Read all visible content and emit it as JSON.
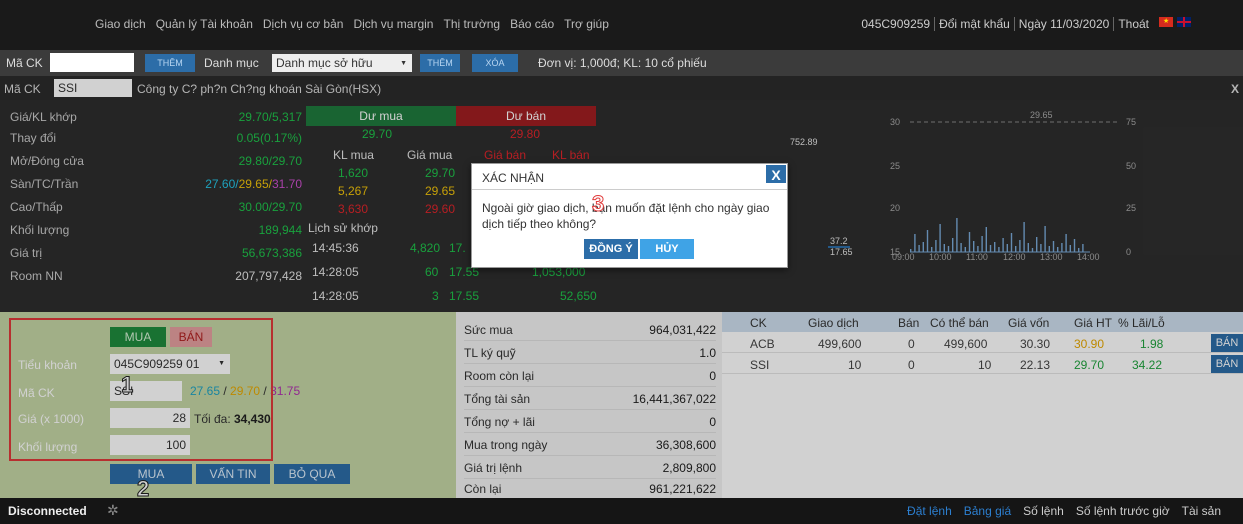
{
  "nav": {
    "menu": [
      "Giao dịch",
      "Quản lý Tài khoản",
      "Dịch vụ cơ bản",
      "Dịch vụ margin",
      "Thị trường",
      "Báo cáo",
      "Trợ giúp"
    ],
    "account": [
      "045C909259",
      "Đổi mật khẩu",
      "Ngày 11/03/2020",
      "Thoát"
    ],
    "flags": [
      "vn-flag-icon",
      "uk-flag-icon"
    ]
  },
  "toolbar": {
    "code_label": "Mã CK",
    "add_label": "THÊM",
    "list_label": "Danh mục",
    "list_select": "Danh mục sở hữu",
    "add2_label": "THÊM",
    "delete_label": "XÓA",
    "unit_text": "Đơn vị: 1,000đ; KL: 10 cổ phiếu"
  },
  "quote_header": {
    "label": "Mã CK",
    "symbol": "SSI",
    "company": "Công ty C? ph?n Ch?ng khoán Sài Gòn(HSX)",
    "close": "X"
  },
  "quote": {
    "rows": [
      {
        "k": "Giá/KL khớp",
        "v1": "29.70",
        "v2": "/5,317"
      },
      {
        "k": "Thay đổi",
        "v1": "0.05(0.17%)",
        "v2": ""
      },
      {
        "k": "Mở/Đóng cửa",
        "v1": "29.80",
        "v2": "/29.70"
      },
      {
        "k": "Sàn/TC/Trần",
        "v1": "27.60/",
        "v2": "29.65/",
        "v3": "31.70"
      },
      {
        "k": "Cao/Thấp",
        "v1": "30.00",
        "v2": "/29.70"
      },
      {
        "k": "Khối lượng",
        "v1": "189,944",
        "v2": ""
      },
      {
        "k": "Giá trị",
        "v1": "56,673,386",
        "v2": ""
      },
      {
        "k": "Room NN",
        "v1": "207,797,428",
        "v2": ""
      }
    ],
    "buy_head": "Dư mua",
    "sell_head": "Dư bán",
    "buy_total": "29.70",
    "sell_total": "29.80",
    "col_kl_mua": "KL mua",
    "col_gia_mua": "Giá mua",
    "col_gia_ban": "Giá bán",
    "col_kl_ban": "KL bán",
    "depth": [
      {
        "kl": "1,620",
        "gia": "29.70"
      },
      {
        "kl": "5,267",
        "gia": "29.65"
      },
      {
        "kl": "3,630",
        "gia": "29.60"
      }
    ],
    "history_label": "Lịch sử khớp",
    "history": [
      {
        "t": "14:45:36",
        "kl": "4,820",
        "p": "17."
      },
      {
        "t": "14:28:05",
        "kl": "60",
        "p": "17.55",
        "amt": "1,053,000"
      },
      {
        "t": "14:28:05",
        "kl": "3",
        "p": "17.55",
        "amt": "52,650"
      }
    ],
    "mini_vals": [
      "752.89",
      "37.2",
      "17.65"
    ]
  },
  "chart_data": {
    "type": "line",
    "title": "",
    "xlabel": "",
    "ylabel": "",
    "x": [
      "09:00",
      "10:00",
      "11:00",
      "12:00",
      "13:00",
      "14:00"
    ],
    "y_left_ticks": [
      "30",
      "25",
      "20",
      "15"
    ],
    "y_right_ticks": [
      "75",
      "50",
      "25",
      "0"
    ],
    "reference_label": "29.65",
    "series": [
      {
        "values": [
          29.8,
          29.9,
          30.0,
          29.85,
          29.75,
          29.7
        ]
      }
    ]
  },
  "order": {
    "buy_tab": "MUA",
    "sell_tab": "BÁN",
    "account_label": "Tiểu khoản",
    "account_value": "045C909259 01",
    "code_label": "Mã CK",
    "code_value": "SSI",
    "code_floor": "27.65",
    "code_sep1": " / ",
    "code_ref": "29.70",
    "code_sep2": " / ",
    "code_ceil": "31.75",
    "price_label": "Giá (x 1000)",
    "price_value": "28",
    "max_label": "Tối đa:",
    "max_value": "34,430",
    "qty_label": "Khối lượng",
    "qty_value": "100",
    "submit_label": "MUA",
    "ask_label": "VẤN TIN",
    "skip_label": "BỎ QUA",
    "badge1": "1",
    "badge2": "2"
  },
  "summary": {
    "rows": [
      {
        "k": "Sức mua",
        "v": "964,031,422"
      },
      {
        "k": "TL ký quỹ",
        "v": "1.0"
      },
      {
        "k": "Room còn lại",
        "v": "0"
      },
      {
        "k": "Tổng tài sản",
        "v": "16,441,367,022"
      },
      {
        "k": "Tổng nợ + lãi",
        "v": "0"
      },
      {
        "k": "Mua trong ngày",
        "v": "36,308,600"
      },
      {
        "k": "Giá trị lệnh",
        "v": "2,809,800"
      },
      {
        "k": "Còn lại",
        "v": "961,221,622"
      }
    ]
  },
  "portfolio": {
    "headers": [
      "CK",
      "Giao dịch",
      "Bán",
      "Có thể bán",
      "Giá vốn",
      "Giá HT",
      "% Lãi/Lỗ"
    ],
    "rows": [
      {
        "ck": "ACB",
        "gd": "499,600",
        "ban": "0",
        "ctb": "499,600",
        "gv": "30.30",
        "ght": "30.90",
        "pct": "1.98",
        "btn": "BÁN"
      },
      {
        "ck": "SSI",
        "gd": "10",
        "ban": "0",
        "ctb": "10",
        "gv": "22.13",
        "ght": "29.70",
        "pct": "34.22",
        "btn": "BÁN"
      }
    ]
  },
  "status": {
    "connection": "Disconnected",
    "links": [
      "Đặt lệnh",
      "Bảng giá",
      "Số lệnh",
      "Số lệnh trước giờ",
      "Tài sản"
    ]
  },
  "modal": {
    "title": "XÁC NHẬN",
    "close": "X",
    "message": "Ngoài giờ giao dịch, bạn muốn đặt lệnh cho ngày giao dịch tiếp theo không?",
    "ok_label": "ĐỒNG Ý",
    "cancel_label": "HỦY",
    "badge3": "3"
  }
}
